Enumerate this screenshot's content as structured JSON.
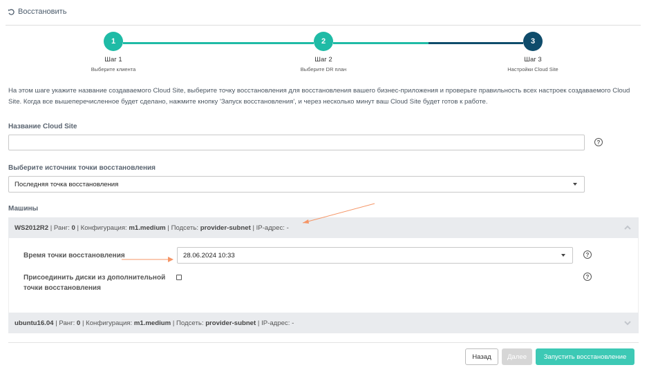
{
  "header": {
    "title": "Восстановить",
    "icon": "restore-icon"
  },
  "steps": [
    {
      "number": "1",
      "title": "Шаг 1",
      "subtitle": "Выберите клиента"
    },
    {
      "number": "2",
      "title": "Шаг 2",
      "subtitle": "Выберите DR план"
    },
    {
      "number": "3",
      "title": "Шаг 3",
      "subtitle": "Настройки Cloud Site"
    }
  ],
  "colors": {
    "accent": "#1fbba6",
    "active_step": "#0f4c6b",
    "disabled": "#d6d6d6"
  },
  "description": "На этом шаге укажите название создаваемого Cloud Site, выберите точку восстановления для восстановления вашего бизнес-приложения и проверьте правильность всех настроек создаваемого Cloud Site. Когда все вышеперечисленное будет сделано, нажмите кнопку 'Запуск восстановления', и через несколько минут ваш Cloud Site будет готов к работе.",
  "cloud_site_name": {
    "label": "Название Cloud Site",
    "value": ""
  },
  "restore_source": {
    "label": "Выберите источник точки восстановления",
    "value": "Последняя точка восстановления"
  },
  "machines_label": "Машины",
  "machines": [
    {
      "name": "WS2012R2",
      "rank_label": "Ранг:",
      "rank": "0",
      "config_label": "Конфигурация:",
      "config": "m1.medium",
      "subnet_label": "Подсеть:",
      "subnet": "provider-subnet",
      "ip_label": "IP-адрес:",
      "ip": "-",
      "expanded": true,
      "restore_time_label": "Время точки восстановления",
      "restore_time": "28.06.2024 10:33",
      "attach_disks_label_1": "Присоединить диски из дополнительной",
      "attach_disks_label_2": "точки восстановления",
      "attach_disks_checked": false
    },
    {
      "name": "ubuntu16.04",
      "rank_label": "Ранг:",
      "rank": "0",
      "config_label": "Конфигурация:",
      "config": "m1.medium",
      "subnet_label": "Подсеть:",
      "subnet": "provider-subnet",
      "ip_label": "IP-адрес:",
      "ip": "-",
      "expanded": false
    }
  ],
  "buttons": {
    "back": "Назад",
    "next": "Далее",
    "run": "Запустить восстановление"
  }
}
